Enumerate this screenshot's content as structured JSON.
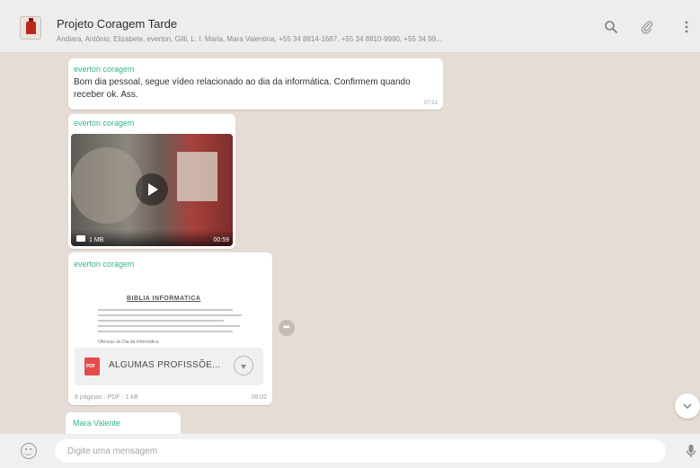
{
  "header": {
    "title": "Projeto Coragem Tarde",
    "members": "Andiara, Antônio, Elizabete, everton, Gilli, L. I. Maria, Mara Valentina, +55 34 8814-1687, +55 34 8810-9990, +55 34 99...",
    "icons": [
      "search-icon",
      "paperclip-icon",
      "more-vertical-icon"
    ]
  },
  "messages": {
    "m1": {
      "sender": "everton coragem",
      "text": "Bom dia pessoal, segue vídeo relacionado ao dia da informática. Confirmem quando receber ok. Ass.",
      "time": "07:51"
    },
    "m2": {
      "sender": "everton coragem",
      "video_size": "1 MB",
      "video_duration": "00:59"
    },
    "m3": {
      "sender": "everton coragem",
      "doc_title": "BIBLIA INFORMATICA",
      "doc_subtitle": "Ofensas do Dia da Informática",
      "file_name": "ALGUMAS PROFISSÕE...",
      "file_meta": "8 páginas · PDF · 1 kB",
      "time": "08:02"
    },
    "m4": {
      "sender": "Mara Valente"
    }
  },
  "composer": {
    "placeholder": "Digite uma mensagem"
  },
  "colors": {
    "chat_background": "#e5ddd5",
    "sender_name": "#35b48c",
    "header_background": "#ededed"
  }
}
